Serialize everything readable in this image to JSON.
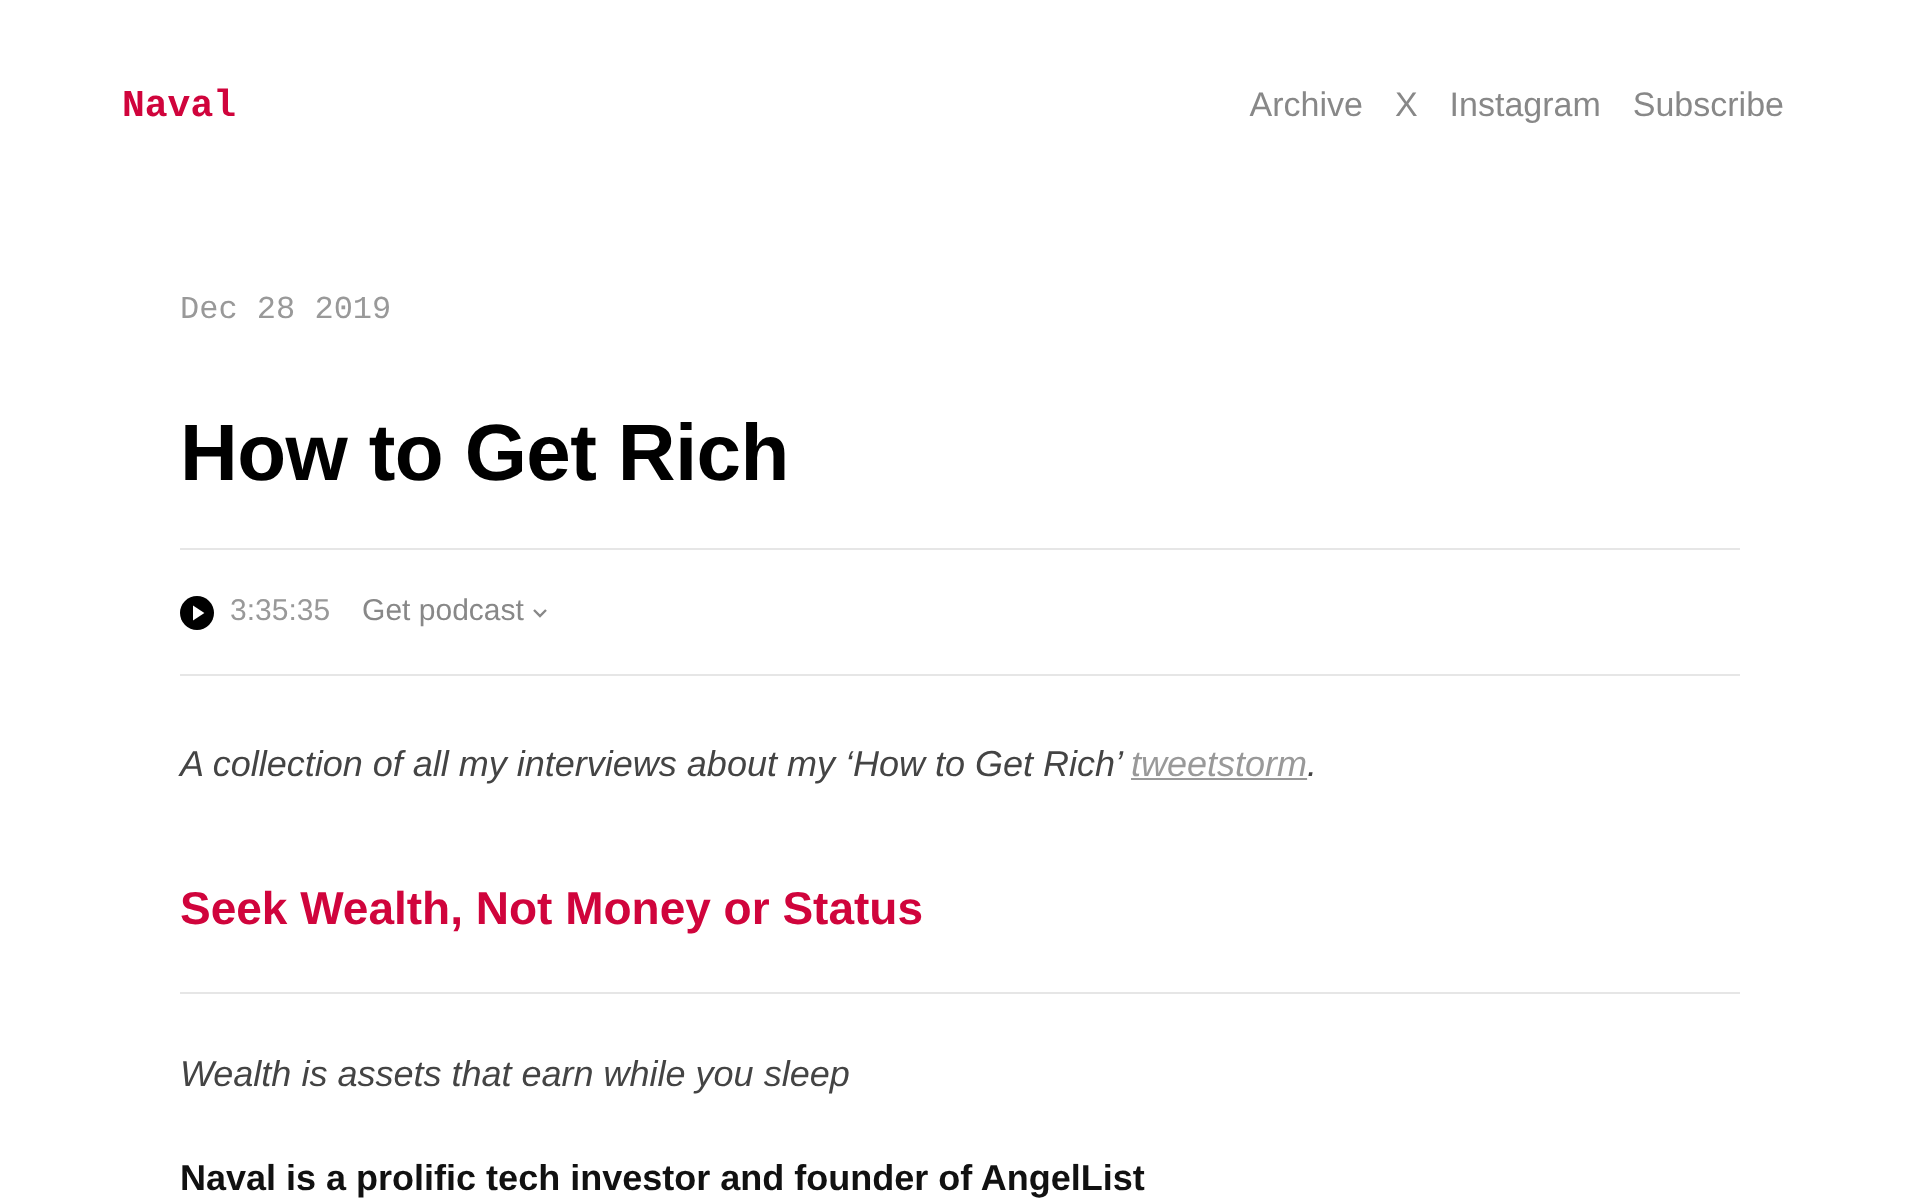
{
  "header": {
    "logo": "Naval",
    "nav": [
      "Archive",
      "X",
      "Instagram",
      "Subscribe"
    ]
  },
  "post": {
    "date": "Dec 28 2019",
    "title": "How to Get Rich"
  },
  "podcast": {
    "duration": "3:35:35",
    "menu": "Get podcast"
  },
  "intro": {
    "text": "A collection of all my interviews about my ‘How to Get Rich’ ",
    "link": "tweetstorm",
    "end": "."
  },
  "sections": [
    {
      "heading": "Seek Wealth, Not Money or Status",
      "blocks": [
        {
          "kind": "subtitle",
          "text": "Wealth is assets that earn while you sleep"
        },
        {
          "kind": "lead",
          "text": "Naval is a prolific tech investor and founder of AngelList"
        }
      ]
    }
  ]
}
